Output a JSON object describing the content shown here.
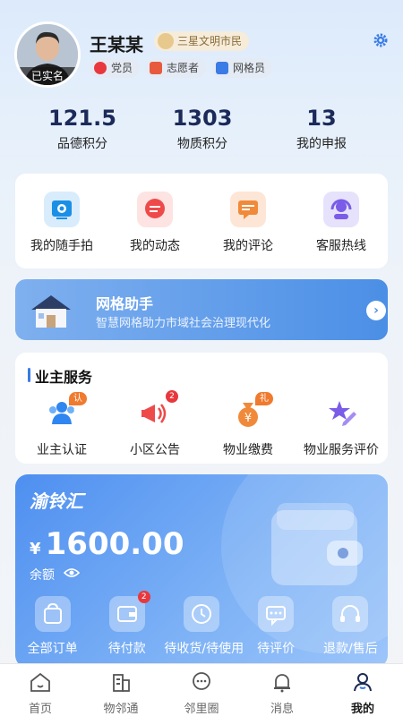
{
  "profile": {
    "name": "王某某",
    "verified_label": "已实名",
    "title_badge": "三星文明市民",
    "tags": [
      "党员",
      "志愿者",
      "网格员"
    ]
  },
  "stats": [
    {
      "value": "121.5",
      "label": "品德积分"
    },
    {
      "value": "1303",
      "label": "物质积分"
    },
    {
      "value": "13",
      "label": "我的申报"
    }
  ],
  "quick": [
    {
      "label": "我的随手拍",
      "icon": "camera-icon"
    },
    {
      "label": "我的动态",
      "icon": "message-icon"
    },
    {
      "label": "我的评论",
      "icon": "comment-icon"
    },
    {
      "label": "客服热线",
      "icon": "headset-icon"
    }
  ],
  "assistant": {
    "title": "网格助手",
    "subtitle": "智慧网格助力市域社会治理现代化"
  },
  "owner_services": {
    "heading": "业主服务",
    "items": [
      {
        "label": "业主认证",
        "badge": "认证",
        "icon": "users-icon"
      },
      {
        "label": "小区公告",
        "count": "2",
        "icon": "megaphone-icon"
      },
      {
        "label": "物业缴费",
        "badge": "礼包",
        "icon": "money-bag-icon"
      },
      {
        "label": "物业服务评价",
        "icon": "pen-star-icon"
      }
    ]
  },
  "wallet": {
    "brand": "渝铃汇",
    "currency": "¥",
    "amount": "1600.00",
    "balance_label": "余额",
    "orders": [
      {
        "label": "全部订单",
        "icon": "bag-icon"
      },
      {
        "label": "待付款",
        "icon": "wallet-icon",
        "count": "2"
      },
      {
        "label": "待收货/待使用",
        "icon": "clock-icon"
      },
      {
        "label": "待评价",
        "icon": "chat-icon"
      },
      {
        "label": "退款/售后",
        "icon": "headphone-icon"
      }
    ]
  },
  "tabs": [
    {
      "label": "首页",
      "icon": "home-icon"
    },
    {
      "label": "物邻通",
      "icon": "building-icon"
    },
    {
      "label": "邻里圈",
      "icon": "chat-bubble-icon"
    },
    {
      "label": "消息",
      "icon": "bell-icon"
    },
    {
      "label": "我的",
      "icon": "person-icon",
      "active": true
    }
  ],
  "colors": {
    "accent": "#3a7be6",
    "badge_orange": "#f07a2e",
    "badge_red": "#e8383d"
  }
}
